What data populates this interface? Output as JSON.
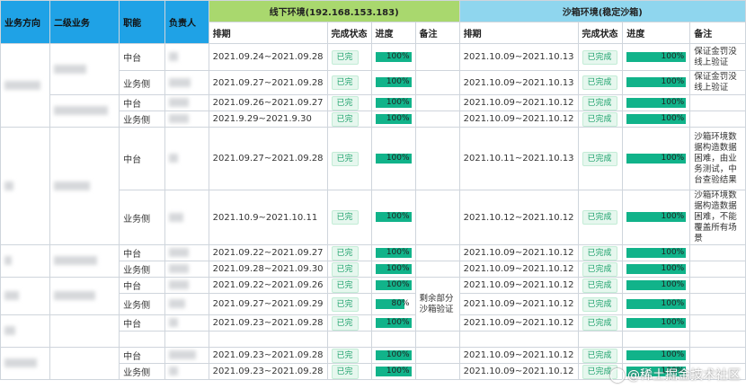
{
  "header": {
    "col_business": "业务方向",
    "col_sub_business": "二级业务",
    "col_role": "职能",
    "col_owner": "负责人",
    "offline_env": "线下环境(192.168.153.183)",
    "sandbox_env": "沙箱环境(稳定沙箱)",
    "schedule": "排期",
    "status": "完成状态",
    "progress": "进度",
    "note": "备注"
  },
  "rows": [
    {
      "role": "中台",
      "off_date": "2021.09.24~2021.09.28",
      "off_status": "已完",
      "off_pct": "100%",
      "off_val": 100,
      "sb_date": "2021.10.09~2021.10.13",
      "sb_status": "已完成",
      "sb_pct": "100%",
      "sb_val": 100,
      "sb_note": "保证金罚没线上验证"
    },
    {
      "role": "业务侧",
      "off_date": "2021.09.27~2021.09.28",
      "off_status": "已完",
      "off_pct": "100%",
      "off_val": 100,
      "sb_date": "2021.10.09~2021.10.13",
      "sb_status": "已完成",
      "sb_pct": "100%",
      "sb_val": 100,
      "sb_note": "保证金罚没线上验证"
    },
    {
      "role": "中台",
      "off_date": "2021.09.26~2021.09.27",
      "off_status": "已完",
      "off_pct": "100%",
      "off_val": 100,
      "sb_date": "2021.10.09~2021.10.12",
      "sb_status": "已完成",
      "sb_pct": "100%",
      "sb_val": 100,
      "sb_note": ""
    },
    {
      "role": "业务侧",
      "off_date": "2021.9.29~2021.9.30",
      "off_status": "已完",
      "off_pct": "100%",
      "off_val": 100,
      "sb_date": "2021.10.09~2021.10.12",
      "sb_status": "已完成",
      "sb_pct": "100%",
      "sb_val": 100,
      "sb_note": ""
    },
    {
      "role": "中台",
      "off_date": "2021.09.27~2021.09.28",
      "off_status": "已完",
      "off_pct": "100%",
      "off_val": 100,
      "sb_date": "2021.10.11~2021.10.13",
      "sb_status": "已完成",
      "sb_pct": "100%",
      "sb_val": 100,
      "sb_note": "沙箱环境数据构造数据困难，由业务测试，中台查验结果"
    },
    {
      "role": "业务侧",
      "off_date": "2021.10.9~2021.10.11",
      "off_status": "已完",
      "off_pct": "100%",
      "off_val": 100,
      "sb_date": "2021.10.12~2021.10.12",
      "sb_status": "已完成",
      "sb_pct": "100%",
      "sb_val": 100,
      "sb_note": "沙箱环境数据构造数据困难，不能覆盖所有场景"
    },
    {
      "role": "中台",
      "off_date": "2021.09.22~2021.09.27",
      "off_status": "已完",
      "off_pct": "100%",
      "off_val": 100,
      "sb_date": "2021.10.09~2021.10.12",
      "sb_status": "已完成",
      "sb_pct": "100%",
      "sb_val": 100,
      "sb_note": ""
    },
    {
      "role": "业务侧",
      "off_date": "2021.09.28~2021.09.30",
      "off_status": "已完",
      "off_pct": "100%",
      "off_val": 100,
      "sb_date": "2021.10.09~2021.10.12",
      "sb_status": "已完成",
      "sb_pct": "100%",
      "sb_val": 100,
      "sb_note": ""
    },
    {
      "role": "中台",
      "off_date": "2021.09.22~2021.09.26",
      "off_status": "已完",
      "off_pct": "100%",
      "off_val": 100,
      "sb_date": "2021.10.09~2021.10.12",
      "sb_status": "已完成",
      "sb_pct": "100%",
      "sb_val": 100,
      "sb_note": ""
    },
    {
      "role": "业务侧",
      "off_date": "2021.09.27~2021.09.29",
      "off_status": "已完",
      "off_pct": "80%",
      "off_val": 80,
      "sb_date": "2021.10.09~2021.10.12",
      "sb_status": "已完成",
      "sb_pct": "100%",
      "sb_val": 100,
      "sb_note": ""
    },
    {
      "role": "中台",
      "off_date": "2021.09.23~2021.09.28",
      "off_status": "已完",
      "off_pct": "100%",
      "off_val": 100,
      "sb_date": "2021.10.09~2021.10.12",
      "sb_status": "已完成",
      "sb_pct": "100%",
      "sb_val": 100,
      "sb_note": ""
    },
    {
      "role": "",
      "off_date": "",
      "off_status": "",
      "off_pct": "",
      "off_val": 0,
      "sb_date": "",
      "sb_status": "",
      "sb_pct": "",
      "sb_val": 0,
      "sb_note": ""
    },
    {
      "role": "中台",
      "off_date": "2021.09.23~2021.09.28",
      "off_status": "已完",
      "off_pct": "100%",
      "off_val": 100,
      "sb_date": "2021.10.09~2021.10.12",
      "sb_status": "已完成",
      "sb_pct": "100%",
      "sb_val": 100,
      "sb_note": ""
    },
    {
      "role": "业务侧",
      "off_date": "2021.09.23~2021.09.28",
      "off_status": "已完",
      "off_pct": "100%",
      "off_val": 100,
      "sb_date": "2021.10.09~2021.10.12",
      "sb_status": "已完成",
      "sb_pct": "100%",
      "sb_val": 100,
      "sb_note": ""
    }
  ],
  "merged_note": "剩余部分沙箱验证",
  "watermark": "@稀土掘金技术社区"
}
